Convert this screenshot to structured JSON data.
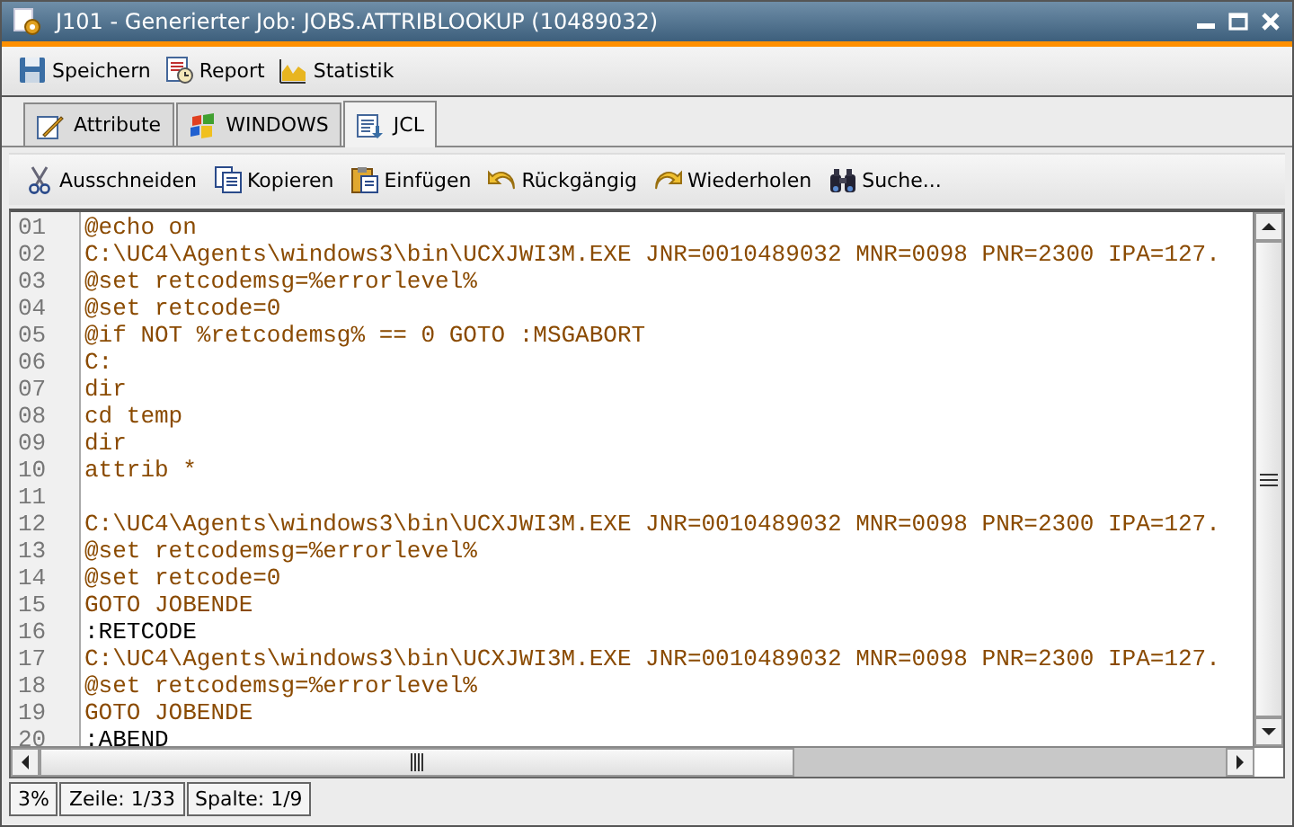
{
  "window": {
    "title": "J101 - Generierter Job: JOBS.ATTRIBLOOKUP (10489032)"
  },
  "toolbar": [
    {
      "label": "Speichern"
    },
    {
      "label": "Report"
    },
    {
      "label": "Statistik"
    }
  ],
  "tabs": [
    {
      "label": "Attribute",
      "selected": false
    },
    {
      "label": "WINDOWS",
      "selected": false
    },
    {
      "label": "JCL",
      "selected": true
    }
  ],
  "edit_toolbar": [
    {
      "label": "Ausschneiden"
    },
    {
      "label": "Kopieren"
    },
    {
      "label": "Einfügen"
    },
    {
      "label": "Rückgängig"
    },
    {
      "label": "Wiederholen"
    },
    {
      "label": "Suche..."
    }
  ],
  "editor": {
    "lines": [
      {
        "number": "01",
        "kind": "command",
        "text": "@echo on"
      },
      {
        "number": "02",
        "kind": "command",
        "text": "C:\\UC4\\Agents\\windows3\\bin\\UCXJWI3M.EXE JNR=0010489032 MNR=0098 PNR=2300 IPA=127."
      },
      {
        "number": "03",
        "kind": "command",
        "text": "@set retcodemsg=%errorlevel%"
      },
      {
        "number": "04",
        "kind": "command",
        "text": "@set retcode=0"
      },
      {
        "number": "05",
        "kind": "command",
        "text": "@if NOT %retcodemsg% == 0 GOTO :MSGABORT"
      },
      {
        "number": "06",
        "kind": "command",
        "text": "C:"
      },
      {
        "number": "07",
        "kind": "command",
        "text": "dir"
      },
      {
        "number": "08",
        "kind": "command",
        "text": "cd temp"
      },
      {
        "number": "09",
        "kind": "command",
        "text": "dir"
      },
      {
        "number": "10",
        "kind": "command",
        "text": "attrib *"
      },
      {
        "number": "11"
      },
      {
        "number": "12",
        "kind": "command",
        "text": "C:\\UC4\\Agents\\windows3\\bin\\UCXJWI3M.EXE JNR=0010489032 MNR=0098 PNR=2300 IPA=127."
      },
      {
        "number": "13",
        "kind": "command",
        "text": "@set retcodemsg=%errorlevel%"
      },
      {
        "number": "14",
        "kind": "command",
        "text": "@set retcode=0"
      },
      {
        "number": "15",
        "kind": "command",
        "text": "GOTO JOBENDE"
      },
      {
        "number": "16",
        "kind": "label",
        "text": ":RETCODE"
      },
      {
        "number": "17",
        "kind": "command",
        "text": "C:\\UC4\\Agents\\windows3\\bin\\UCXJWI3M.EXE JNR=0010489032 MNR=0098 PNR=2300 IPA=127."
      },
      {
        "number": "18",
        "kind": "command",
        "text": "@set retcodemsg=%errorlevel%"
      },
      {
        "number": "19",
        "kind": "command",
        "text": "GOTO JOBENDE"
      },
      {
        "number": "20",
        "kind": "label",
        "text": ":ABEND"
      }
    ]
  },
  "status_bar": [
    "3%",
    "Zeile: 1/33",
    "Spalte: 1/9"
  ]
}
